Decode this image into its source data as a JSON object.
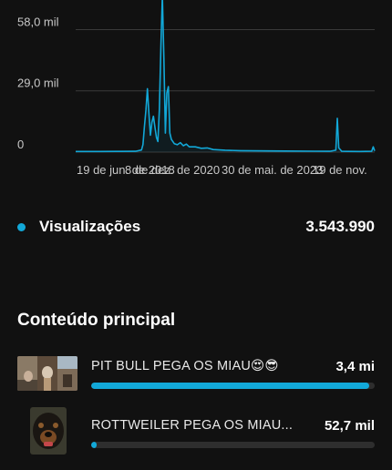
{
  "chart_data": {
    "type": "line",
    "y_ticks": [
      {
        "value": 58000,
        "label": "58,0 mil"
      },
      {
        "value": 29000,
        "label": "29,0 mil"
      },
      {
        "value": 0,
        "label": "0"
      }
    ],
    "ylim": [
      0,
      72000
    ],
    "x_tick_labels": [
      "19 de jun. de 2018",
      "8 de dez. de 2020",
      "30 de mai. de 2023",
      "19 de nov."
    ],
    "series": [
      {
        "color": "#12a8d8",
        "points": [
          [
            0,
            300
          ],
          [
            8,
            300
          ],
          [
            15,
            350
          ],
          [
            20,
            400
          ],
          [
            22,
            1000
          ],
          [
            22.5,
            3500
          ],
          [
            23,
            12000
          ],
          [
            23.5,
            20000
          ],
          [
            24,
            30000
          ],
          [
            24.5,
            18000
          ],
          [
            25,
            8000
          ],
          [
            25.5,
            14000
          ],
          [
            26,
            17000
          ],
          [
            26.5,
            12000
          ],
          [
            27,
            7000
          ],
          [
            27.5,
            5000
          ],
          [
            28,
            20000
          ],
          [
            28.5,
            50000
          ],
          [
            29,
            75000
          ],
          [
            29.5,
            44000
          ],
          [
            30,
            9000
          ],
          [
            30.5,
            28000
          ],
          [
            31,
            31000
          ],
          [
            31.5,
            9000
          ],
          [
            32,
            6000
          ],
          [
            33,
            4000
          ],
          [
            34,
            3500
          ],
          [
            35,
            4500
          ],
          [
            36,
            3000
          ],
          [
            37,
            3800
          ],
          [
            38,
            2500
          ],
          [
            40,
            2500
          ],
          [
            42,
            1800
          ],
          [
            44,
            2000
          ],
          [
            46,
            1200
          ],
          [
            50,
            900
          ],
          [
            55,
            700
          ],
          [
            60,
            600
          ],
          [
            70,
            500
          ],
          [
            80,
            450
          ],
          [
            85,
            400
          ],
          [
            87,
            900
          ],
          [
            87.5,
            16000
          ],
          [
            88,
            2000
          ],
          [
            89,
            400
          ],
          [
            95,
            300
          ],
          [
            99,
            400
          ],
          [
            99.5,
            2500
          ],
          [
            100,
            600
          ]
        ]
      }
    ]
  },
  "metric": {
    "label": "Visualizações",
    "value": "3.543.990"
  },
  "section_title": "Conteúdo principal",
  "items": [
    {
      "title": "PIT BULL PEGA OS MIAU😍😎",
      "value": "3,4 mi",
      "progress": 0.98
    },
    {
      "title": "ROTTWEILER PEGA OS MIAU...",
      "value": "52,7 mil",
      "progress": 0.015
    }
  ]
}
